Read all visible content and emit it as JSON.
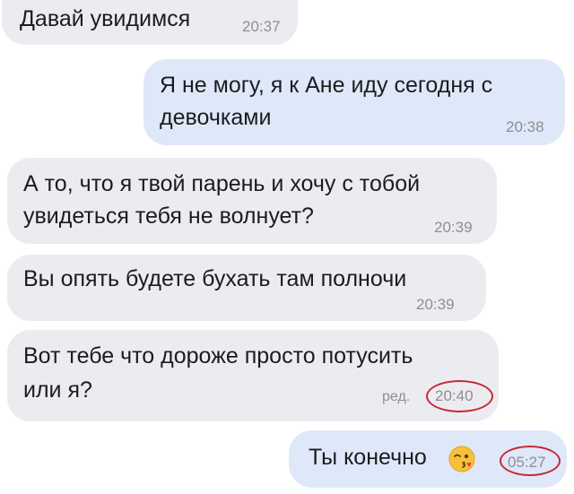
{
  "chat": {
    "messages": [
      {
        "direction": "incoming",
        "lines": [
          "Давай увидимся"
        ],
        "time": "20:37"
      },
      {
        "direction": "outgoing",
        "lines": [
          "Я не могу, я к Ане иду сегодня с",
          "девочками"
        ],
        "time": "20:38"
      },
      {
        "direction": "incoming",
        "lines": [
          "А то, что я твой парень и хочу с тобой",
          "увидеться тебя не волнует?"
        ],
        "time": "20:39"
      },
      {
        "direction": "incoming",
        "lines": [
          "Вы опять будете бухать там полночи"
        ],
        "time": "20:39"
      },
      {
        "direction": "incoming",
        "lines": [
          "Вот тебе что дороже просто потусить",
          "или я?"
        ],
        "time": "20:40",
        "edited_label": "ред."
      },
      {
        "direction": "outgoing",
        "lines": [
          "Ты конечно"
        ],
        "time": "05:27",
        "emoji": "kissing-face-winking-emoji"
      }
    ]
  },
  "colors": {
    "incoming_bubble": "#ececf0",
    "outgoing_bubble": "#dfe8f9",
    "timestamp": "#8e8e93",
    "highlight_circle": "#c52a36"
  }
}
